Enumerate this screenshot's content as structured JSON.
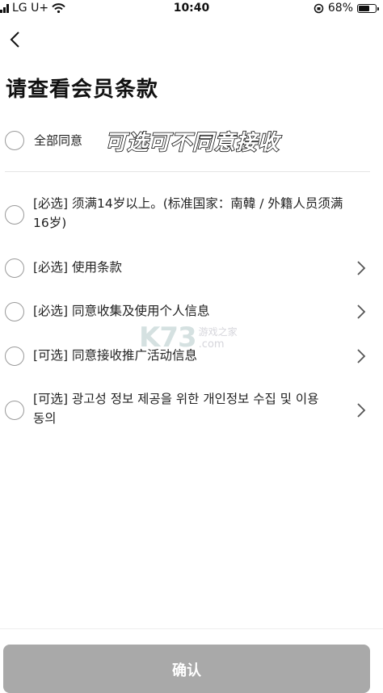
{
  "status_bar": {
    "carrier": "LG U+",
    "time": "10:40",
    "battery": "68%",
    "battery_level": 0.68
  },
  "page": {
    "title": "请查看会员条款"
  },
  "agree_all": {
    "label": "全部同意",
    "banner": "可选可不同意接收"
  },
  "terms": [
    {
      "line1": "[必选] 须满14岁以上。(标准国家：南韓 / 外籍人员须满",
      "line2": "16岁)",
      "has_chevron": false
    },
    {
      "line1": "[必选] 使用条款",
      "has_chevron": true
    },
    {
      "line1": "[必选] 同意收集及使用个人信息",
      "has_chevron": true
    },
    {
      "line1": "[可选] 同意接收推广活动信息",
      "has_chevron": true
    },
    {
      "line1": "[可选] 광고성 정보 제공을 위한 개인정보 수집 및 이용",
      "line2": "동의",
      "has_chevron": true
    }
  ],
  "watermark": {
    "logo": "K73",
    "cn": "游戏之家",
    "com": ".com"
  },
  "footer": {
    "confirm_label": "确认"
  },
  "colors": {
    "button_disabled": "#a9a9a9",
    "radio_border": "#999999"
  }
}
